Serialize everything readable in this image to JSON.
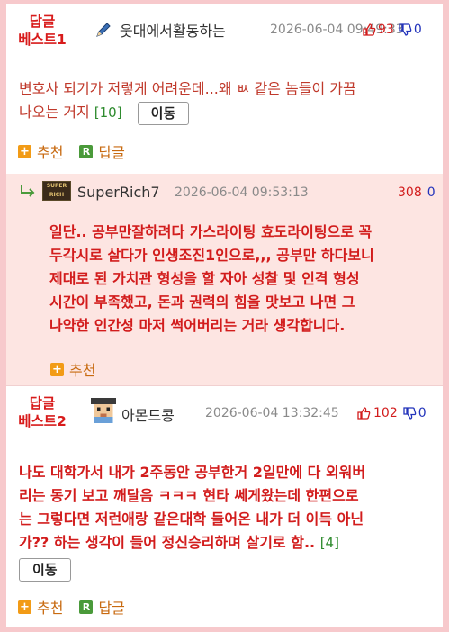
{
  "comments": [
    {
      "best_label_1": "답글",
      "best_label_2": "베스트1",
      "nickname": "웃대에서활동하는",
      "date": "2026-06-04 09:49:33",
      "upvotes": "93",
      "downvotes": "0",
      "text_line1": "변호사 되기가 저렇게 어려운데...왜 ㅄ 같은 놈들이 가끔",
      "text_line2": "나오는 거지",
      "reply_count": "[10]",
      "move_label": "이동",
      "recommend_label": "추천",
      "reply_label": "답글"
    },
    {
      "nickname": "SuperRich7",
      "avatar_text": "SUPER RICH",
      "date": "2026-06-04 09:53:13",
      "upvotes": "308",
      "downvotes": "0",
      "text_lines": [
        "일단.. 공부만잘하려다 가스라이팅 효도라이팅으로 꼭",
        "두각시로 살다가 인생조진1인으로,,, 공부만 하다보니",
        "제대로 된 가치관 형성을 할 자아 성찰 및 인격 형성",
        "시간이 부족했고, 돈과 권력의 힘을 맛보고 나면 그",
        "나약한 인간성 마저 썩어버리는 거라 생각합니다."
      ],
      "recommend_label": "추천"
    },
    {
      "best_label_1": "답글",
      "best_label_2": "베스트2",
      "nickname": "아몬드콩",
      "date": "2026-06-04 13:32:45",
      "upvotes": "102",
      "downvotes": "0",
      "text_lines": [
        "나도 대학가서 내가 2주동안 공부한거 2일만에 다 외워버",
        "리는 동기 보고 깨달음 ㅋㅋㅋ 현타 쎄게왔는데 한편으로",
        "는 그렇다면 저런애랑 같은대학 들어온 내가 더 이득 아닌",
        "가?? 하는 생각이 들어 정신승리하며 살기로 함.."
      ],
      "reply_count": "[4]",
      "move_label": "이동",
      "recommend_label": "추천",
      "reply_label": "답글"
    }
  ],
  "colors": {
    "border_pink": "#f7c9cc",
    "reply_bg": "#fde5e2",
    "upvote_red": "#d21c1c",
    "downvote_blue": "#2233bb",
    "action_orange": "#c86a10"
  }
}
